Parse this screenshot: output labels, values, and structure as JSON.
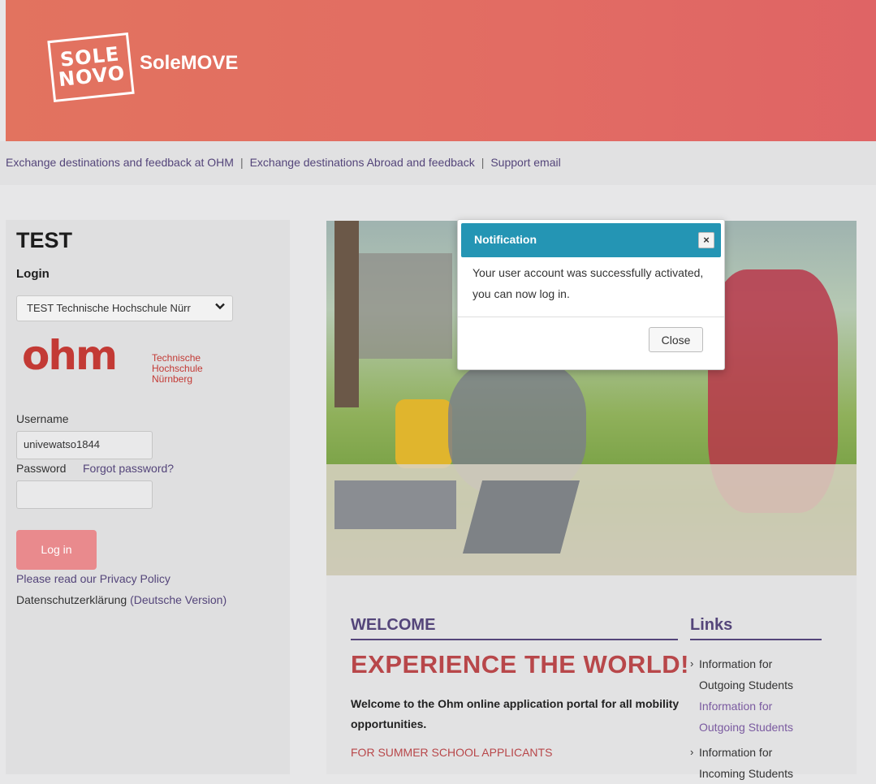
{
  "header": {
    "logo_line1": "SOLE",
    "logo_line2": "NOVO",
    "brand_name": "SoleMOVE"
  },
  "topnav": {
    "links": [
      {
        "label": "Exchange destinations and feedback at OHM"
      },
      {
        "label": "Exchange destinations Abroad and feedback"
      },
      {
        "label": "Support email"
      }
    ],
    "separator": "|"
  },
  "login": {
    "title": "TEST",
    "subtitle": "Login",
    "institution_selected": "TEST Technische Hochschule Nürr",
    "institution_logo": {
      "word": "ohm",
      "line1": "Technische",
      "line2": "Hochschule",
      "line3": "Nürnberg"
    },
    "username_label": "Username",
    "username_value": "univewatso1844",
    "password_label": "Password",
    "forgot_label": "Forgot password?",
    "password_value": "",
    "login_button": "Log in",
    "privacy_link": "Please read our Privacy Policy",
    "datenschutz_text": "Datenschutzerklärung",
    "datenschutz_link": "(Deutsche Version)"
  },
  "main": {
    "welcome": "WELCOME",
    "experience": "EXPERIENCE THE WORLD!",
    "welcome_text": "Welcome to the Ohm online application portal for all mobility opportunities.",
    "summer": "FOR SUMMER SCHOOL APPLICANTS"
  },
  "links": {
    "title": "Links",
    "items": [
      {
        "line1": "Information for",
        "line2": "Outgoing Students",
        "line3": "Information for",
        "line4": "Outgoing Students"
      },
      {
        "line1": "Information for",
        "line2": "Incoming Students"
      }
    ]
  },
  "modal": {
    "title": "Notification",
    "close_icon": "×",
    "message": "Your user account was successfully activated, you can now log in.",
    "close_button": "Close"
  },
  "colors": {
    "banner": "#e26c63",
    "nav_link": "#54457a",
    "accent_red": "#b8474a",
    "modal_header": "#2495b4",
    "login_button": "#e98a8d"
  }
}
